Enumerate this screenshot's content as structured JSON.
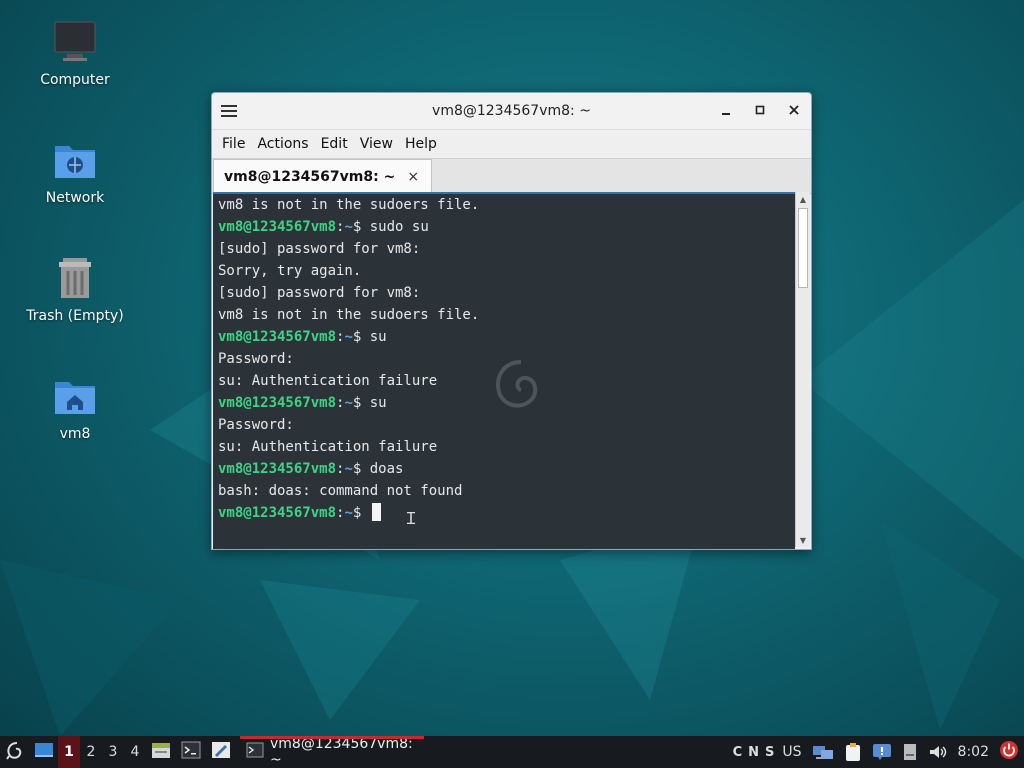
{
  "desktop": {
    "icons": [
      {
        "label": "Computer",
        "icon": "computer-icon"
      },
      {
        "label": "Network",
        "icon": "network-folder-icon"
      },
      {
        "label": "Trash (Empty)",
        "icon": "trash-icon"
      },
      {
        "label": "vm8",
        "icon": "home-folder-icon"
      }
    ]
  },
  "window": {
    "title": "vm8@1234567vm8: ~",
    "controls": {
      "minimize": "minimize-icon",
      "maximize": "maximize-icon",
      "close": "close-icon"
    },
    "menu": [
      "File",
      "Actions",
      "Edit",
      "View",
      "Help"
    ],
    "tab": {
      "label": "vm8@1234567vm8: ~",
      "close": "×"
    }
  },
  "terminal": {
    "prompt_user": "vm8@1234567vm8",
    "prompt_sep": ":",
    "prompt_path": "~",
    "prompt_sign": "$ ",
    "lines": [
      {
        "type": "out",
        "text": "vm8 is not in the sudoers file."
      },
      {
        "type": "cmd",
        "text": "sudo su"
      },
      {
        "type": "out",
        "text": "[sudo] password for vm8:"
      },
      {
        "type": "out",
        "text": "Sorry, try again."
      },
      {
        "type": "out",
        "text": "[sudo] password for vm8:"
      },
      {
        "type": "out",
        "text": "vm8 is not in the sudoers file."
      },
      {
        "type": "cmd",
        "text": "su"
      },
      {
        "type": "out",
        "text": "Password:"
      },
      {
        "type": "out",
        "text": "su: Authentication failure"
      },
      {
        "type": "cmd",
        "text": "su"
      },
      {
        "type": "out",
        "text": "Password:"
      },
      {
        "type": "out",
        "text": "su: Authentication failure"
      },
      {
        "type": "cmd",
        "text": "doas"
      },
      {
        "type": "out",
        "text": "bash: doas: command not found"
      },
      {
        "type": "prompt",
        "text": ""
      }
    ]
  },
  "taskbar": {
    "workspaces": [
      "1",
      "2",
      "3",
      "4"
    ],
    "active_workspace": "1",
    "task_label": "vm8@1234567vm8: ~",
    "keyboard_indicators": [
      "C",
      "N",
      "S"
    ],
    "layout": "US",
    "clock": "8:02",
    "accent_color": "#c82a2a"
  }
}
